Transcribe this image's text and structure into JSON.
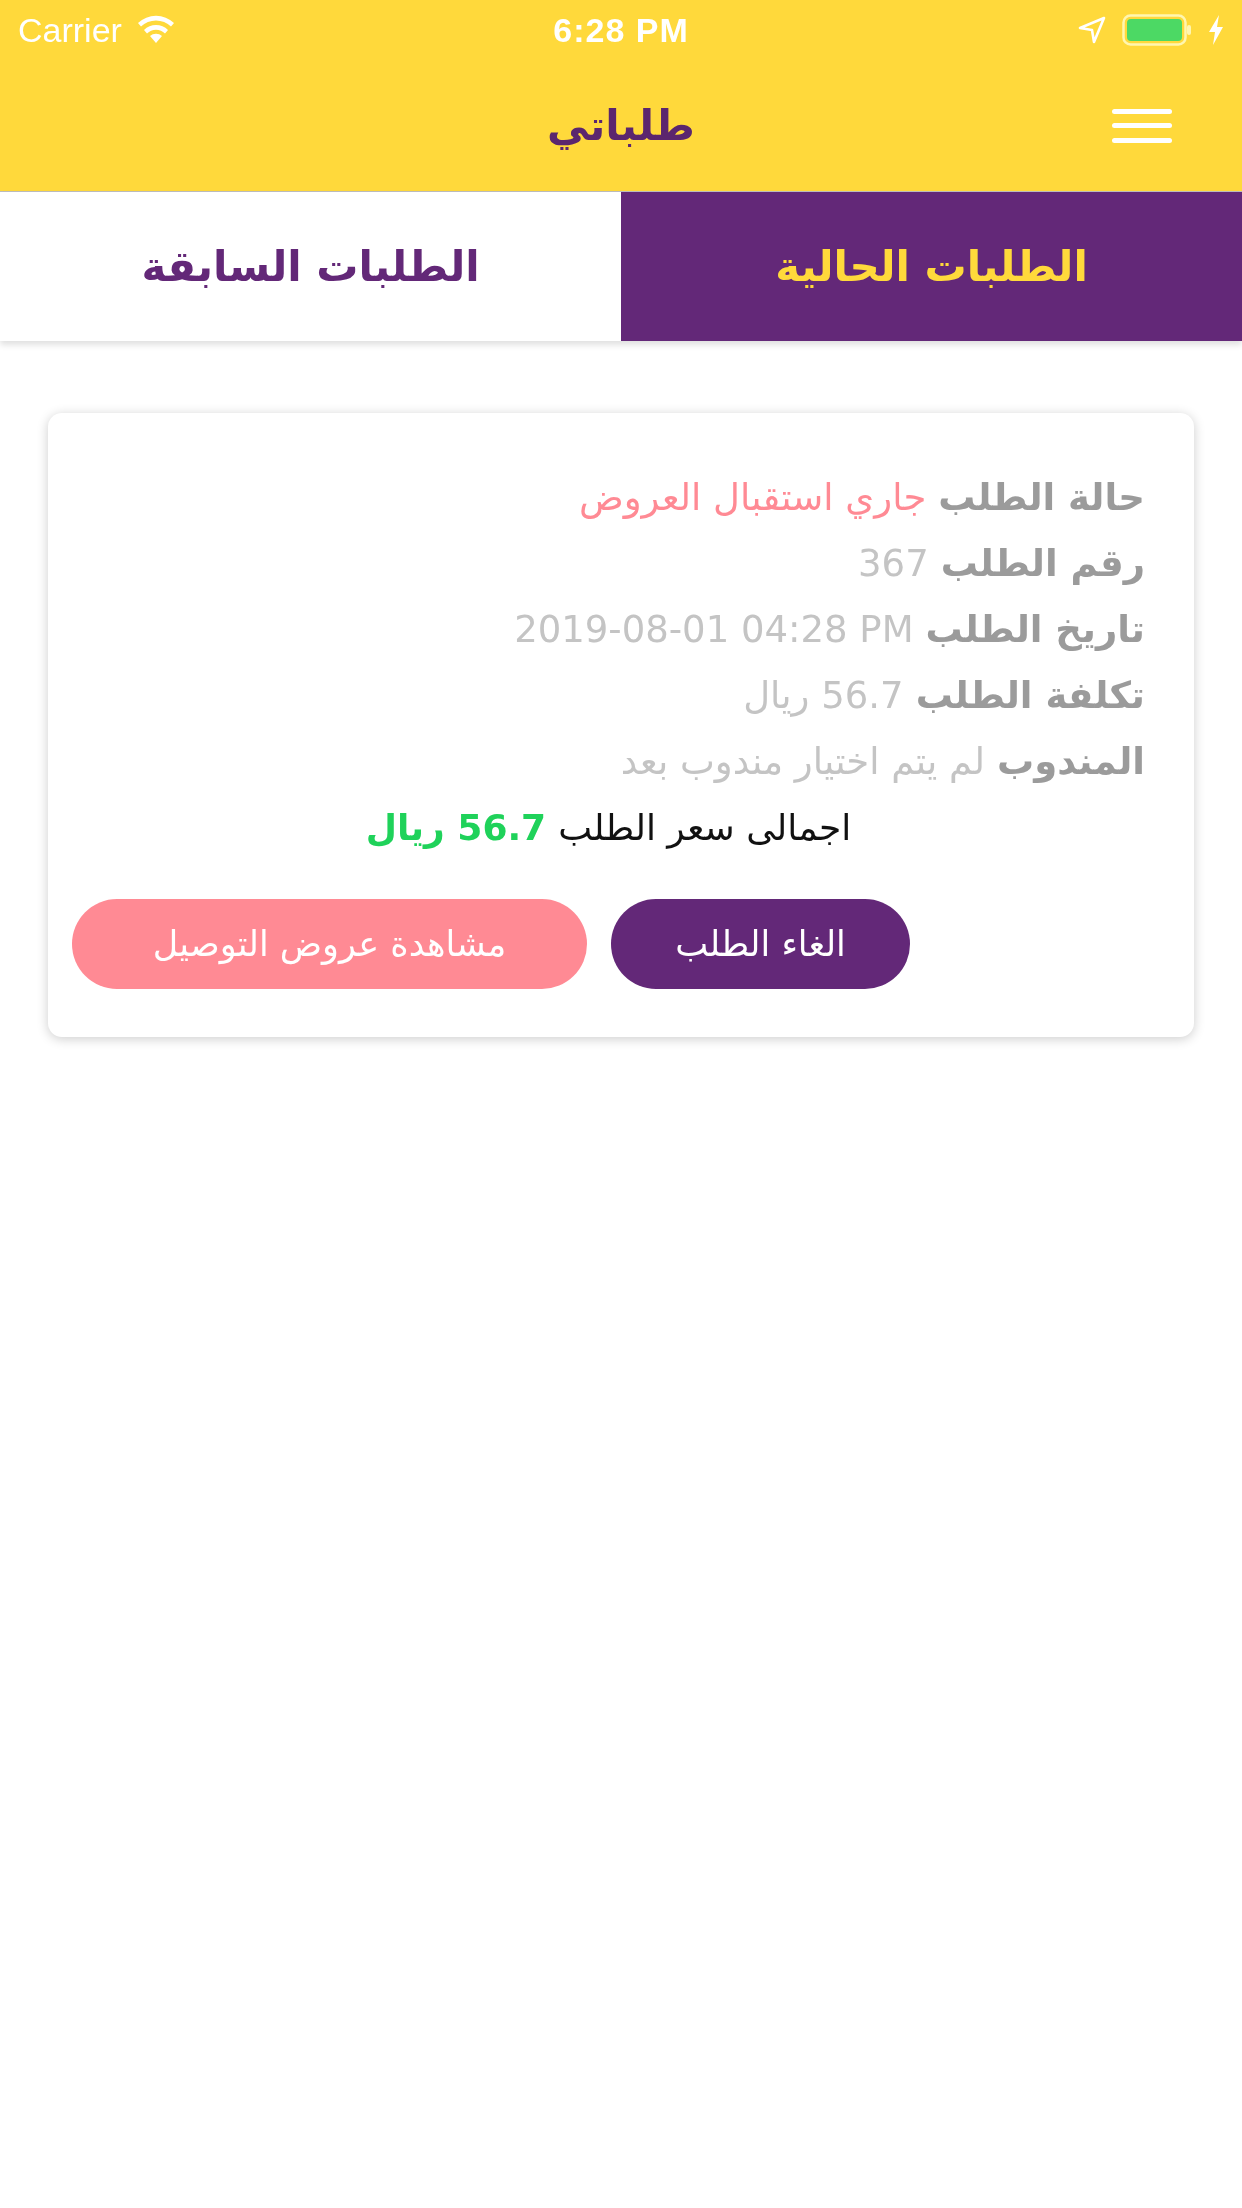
{
  "status_bar": {
    "carrier": "Carrier",
    "time": "6:28 PM"
  },
  "header": {
    "title": "طلباتي"
  },
  "tabs": [
    {
      "label": "الطلبات الحالية",
      "selected": true
    },
    {
      "label": "الطلبات السابقة",
      "selected": false
    }
  ],
  "orders": [
    {
      "fields": [
        {
          "label": "حالة الطلب",
          "value": "جاري استقبال العروض",
          "color": "#ff8a94"
        },
        {
          "label": "رقم الطلب",
          "value": "367",
          "color": "#c4c4c4"
        },
        {
          "label": "تاريخ الطلب",
          "value": "2019-08-01 04:28 PM",
          "color": "#c4c4c4"
        },
        {
          "label": "تكلفة الطلب",
          "value": "56.7 ريال",
          "color": "#c4c4c4"
        },
        {
          "label": "المندوب",
          "value": "لم يتم اختيار مندوب بعد",
          "color": "#c4c4c4"
        }
      ],
      "total": {
        "label": "اجمالى سعر الطلب",
        "value": "56.7 ريال"
      },
      "buttons": [
        {
          "label": "الغاء الطلب",
          "kind": "cancel"
        },
        {
          "label": "مشاهدة عروض التوصيل",
          "kind": "offers"
        }
      ]
    }
  ]
}
